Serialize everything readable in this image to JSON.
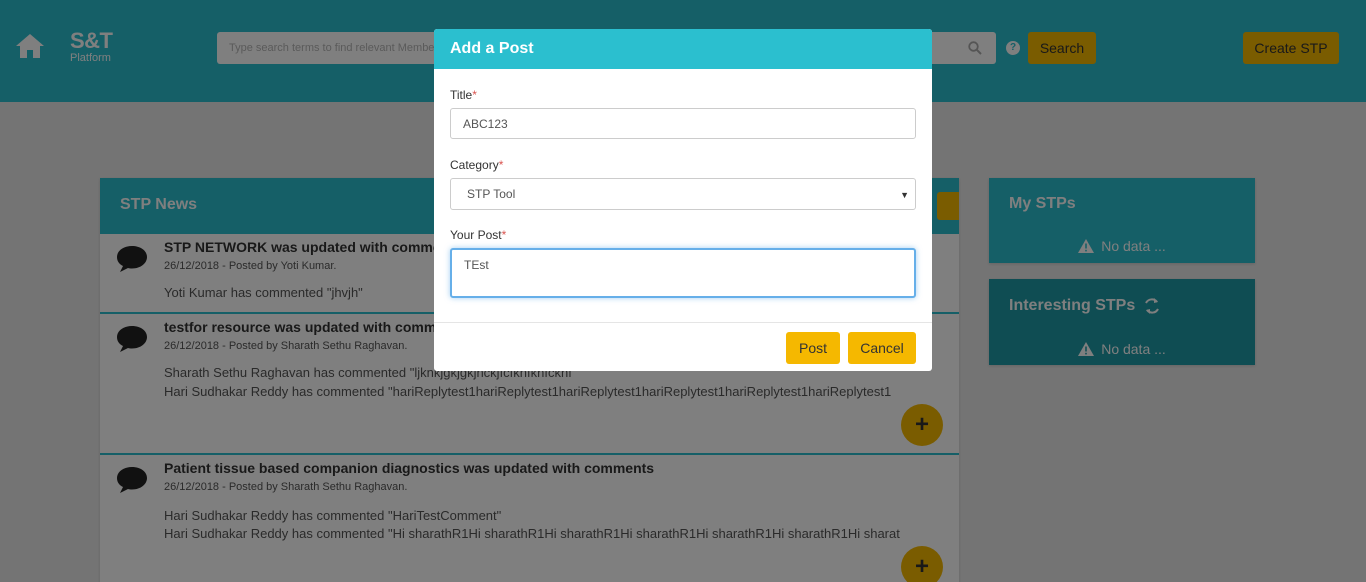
{
  "header": {
    "brand_title": "S&T",
    "brand_subtitle": "Platform",
    "search_placeholder": "Type search terms to find relevant Members, Content, or STP Platforms",
    "search_button": "Search",
    "create_button": "Create STP"
  },
  "news": {
    "title": "STP News",
    "items": [
      {
        "title": "STP NETWORK was updated with comments",
        "meta": "26/12/2018 - Posted by Yoti Kumar.",
        "comments": [
          "Yoti Kumar has commented \"jhvjh\""
        ]
      },
      {
        "title": "testfor resource was updated with comments",
        "meta": "26/12/2018 - Posted by Sharath Sethu Raghavan.",
        "comments": [
          "Sharath Sethu Raghavan has commented \"ljknkjgkjgkjnckjfcfknfknfcknf\"",
          "Hari Sudhakar Reddy has commented \"hariReplytest1hariReplytest1hariReplytest1hariReplytest1hariReplytest1hariReplytest1"
        ]
      },
      {
        "title": "Patient tissue based companion diagnostics was updated with comments",
        "meta": "26/12/2018 - Posted by Sharath Sethu Raghavan.",
        "comments": [
          "Hari Sudhakar Reddy has commented \"HariTestComment\"",
          "Hari Sudhakar Reddy has commented \"Hi sharathR1Hi sharathR1Hi sharathR1Hi sharathR1Hi sharathR1Hi sharathR1Hi sharat"
        ]
      }
    ],
    "plus_label": "+"
  },
  "my_stps": {
    "title": "My STPs",
    "empty": "No data ..."
  },
  "interesting_stps": {
    "title": "Interesting STPs",
    "empty": "No data ..."
  },
  "modal": {
    "title": "Add a Post",
    "title_label": "Title",
    "title_value": "ABC123",
    "category_label": "Category",
    "category_value": "STP Tool",
    "post_label": "Your Post",
    "post_value": "TEst",
    "required_mark": "*",
    "post_button": "Post",
    "cancel_button": "Cancel"
  },
  "colors": {
    "primary": "#2bbfcf",
    "accent": "#f5b800"
  }
}
